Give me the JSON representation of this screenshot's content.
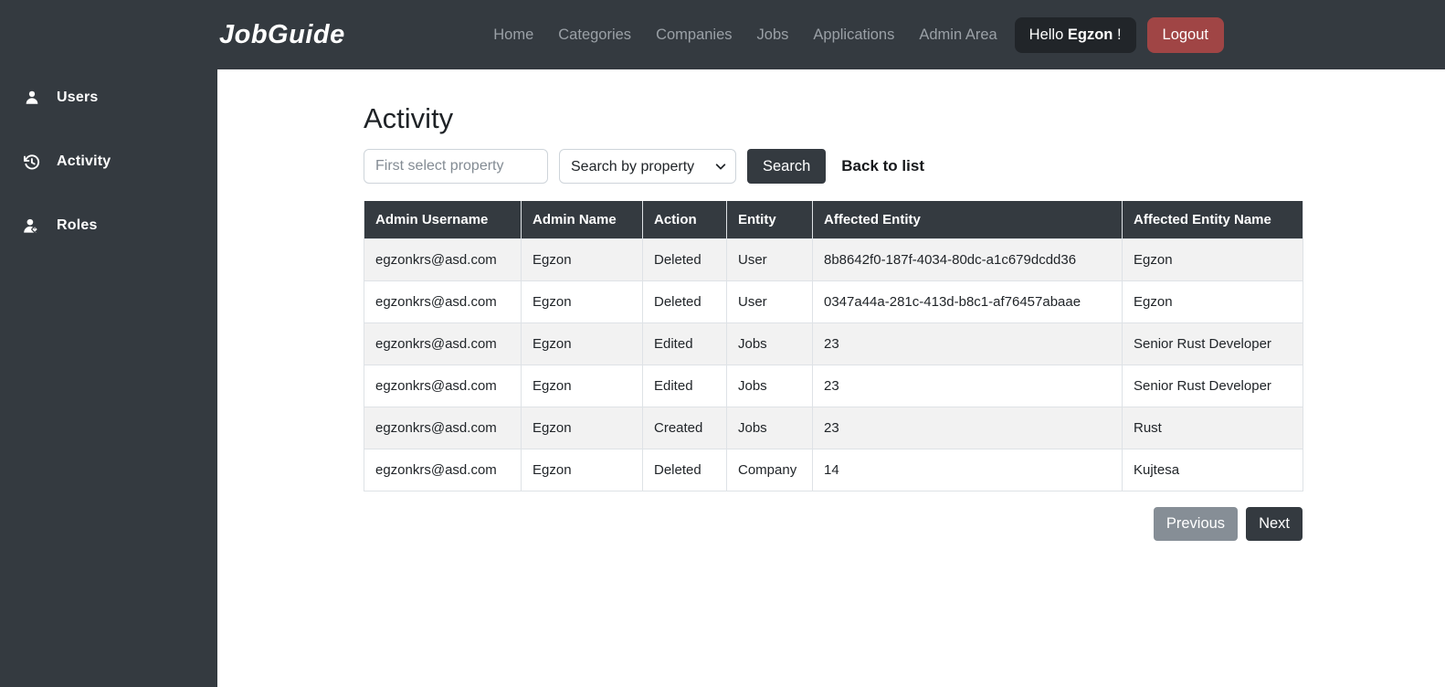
{
  "navbar": {
    "brand": "JobGuide",
    "links": [
      "Home",
      "Categories",
      "Companies",
      "Jobs",
      "Applications",
      "Admin Area"
    ],
    "greeting_prefix": "Hello ",
    "user_name": "Egzon",
    "greeting_suffix": " !",
    "logout_label": "Logout"
  },
  "sidebar": {
    "items": [
      {
        "label": "Users",
        "icon": "user-icon"
      },
      {
        "label": "Activity",
        "icon": "history-icon"
      },
      {
        "label": "Roles",
        "icon": "user-tag-icon"
      }
    ]
  },
  "main": {
    "title": "Activity",
    "search": {
      "input_placeholder": "First select property",
      "select_value": "Search by property",
      "button_label": "Search",
      "back_link": "Back to list"
    },
    "table": {
      "headers": [
        "Admin Username",
        "Admin Name",
        "Action",
        "Entity",
        "Affected Entity",
        "Affected Entity Name"
      ],
      "rows": [
        [
          "egzonkrs@asd.com",
          "Egzon",
          "Deleted",
          "User",
          "8b8642f0-187f-4034-80dc-a1c679dcdd36",
          "Egzon"
        ],
        [
          "egzonkrs@asd.com",
          "Egzon",
          "Deleted",
          "User",
          "0347a44a-281c-413d-b8c1-af76457abaae",
          "Egzon"
        ],
        [
          "egzonkrs@asd.com",
          "Egzon",
          "Edited",
          "Jobs",
          "23",
          "Senior Rust Developer"
        ],
        [
          "egzonkrs@asd.com",
          "Egzon",
          "Edited",
          "Jobs",
          "23",
          "Senior Rust Developer"
        ],
        [
          "egzonkrs@asd.com",
          "Egzon",
          "Created",
          "Jobs",
          "23",
          "Rust"
        ],
        [
          "egzonkrs@asd.com",
          "Egzon",
          "Deleted",
          "Company",
          "14",
          "Kujtesa"
        ]
      ]
    },
    "pagination": {
      "previous_label": "Previous",
      "next_label": "Next"
    }
  },
  "colors": {
    "navbar_bg": "#343a40",
    "greeting_btn_bg": "#212529",
    "logout_btn_bg": "#a04545",
    "table_header_bg": "#343a40",
    "stripe_bg": "#f2f2f2",
    "table_border": "#dee2e6",
    "previous_btn_bg": "#868e96",
    "next_btn_bg": "#343a40"
  }
}
